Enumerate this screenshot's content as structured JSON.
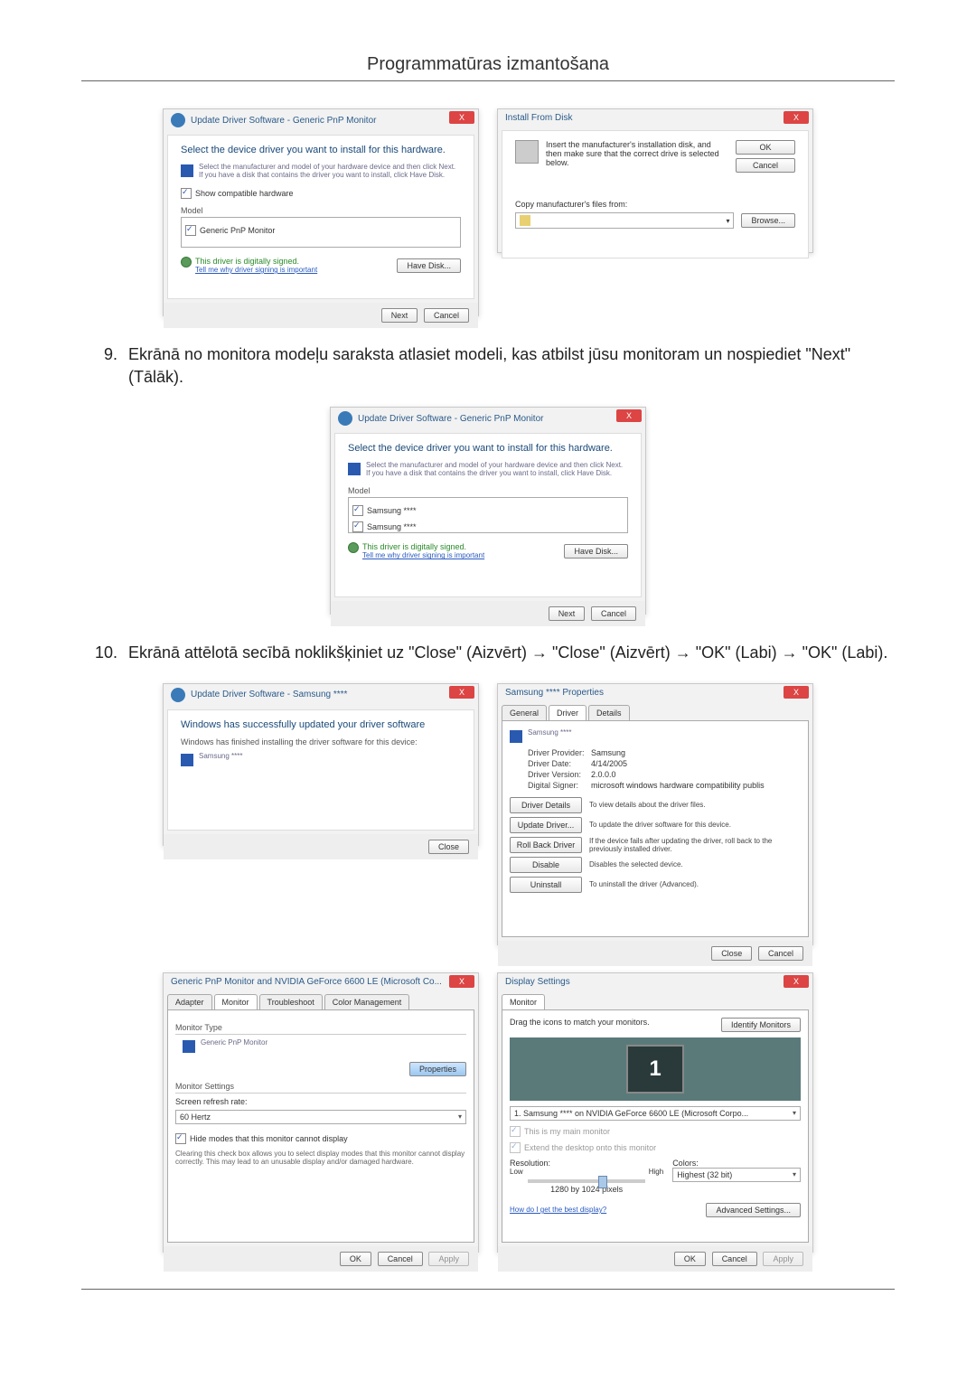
{
  "page": {
    "title": "Programmatūras izmantošana"
  },
  "steps": {
    "s9": {
      "num": "9.",
      "text": "Ekrānā no monitora modeļu saraksta atlasiet modeli, kas atbilst jūsu monitoram un nospiediet \"Next\" (Tālāk)."
    },
    "s10": {
      "num": "10.",
      "text": "Ekrānā attēlotā secībā noklikšķiniet uz \"Close\" (Aizvērt) → \"Close\" (Aizvērt) → \"OK\" (Labi) → \"OK\" (Labi)."
    }
  },
  "shot_update1": {
    "title": "Update Driver Software - Generic PnP Monitor",
    "heading": "Select the device driver you want to install for this hardware.",
    "note": "Select the manufacturer and model of your hardware device and then click Next. If you have a disk that contains the driver you want to install, click Have Disk.",
    "show_compat": "Show compatible hardware",
    "model_label": "Model",
    "model_item": "Generic PnP Monitor",
    "signed": "This driver is digitally signed.",
    "signed_link": "Tell me why driver signing is important",
    "have_disk": "Have Disk...",
    "next": "Next",
    "cancel": "Cancel"
  },
  "shot_install_disk": {
    "title": "Install From Disk",
    "instr": "Insert the manufacturer's installation disk, and then make sure that the correct drive is selected below.",
    "ok": "OK",
    "cancel": "Cancel",
    "copy_label": "Copy manufacturer's files from:",
    "browse": "Browse..."
  },
  "shot_update2": {
    "title": "Update Driver Software - Generic PnP Monitor",
    "heading": "Select the device driver you want to install for this hardware.",
    "note": "Select the manufacturer and model of your hardware device and then click Next. If you have a disk that contains the driver you want to install, click Have Disk.",
    "model_label": "Model",
    "model_item1": "Samsung ****",
    "model_item2": "Samsung ****",
    "signed": "This driver is digitally signed.",
    "signed_link": "Tell me why driver signing is important",
    "have_disk": "Have Disk...",
    "next": "Next",
    "cancel": "Cancel"
  },
  "shot_close": {
    "title": "Update Driver Software - Samsung ****",
    "heading": "Windows has successfully updated your driver software",
    "note": "Windows has finished installing the driver software for this device:",
    "device": "Samsung ****",
    "close": "Close"
  },
  "shot_props": {
    "title": "Samsung **** Properties",
    "tabs": {
      "general": "General",
      "driver": "Driver",
      "details": "Details"
    },
    "device": "Samsung ****",
    "provider_l": "Driver Provider:",
    "provider_v": "Samsung",
    "date_l": "Driver Date:",
    "date_v": "4/14/2005",
    "version_l": "Driver Version:",
    "version_v": "2.0.0.0",
    "signer_l": "Digital Signer:",
    "signer_v": "microsoft windows hardware compatibility publis",
    "b_details": "Driver Details",
    "d_details": "To view details about the driver files.",
    "b_update": "Update Driver...",
    "d_update": "To update the driver software for this device.",
    "b_rollback": "Roll Back Driver",
    "d_rollback": "If the device fails after updating the driver, roll back to the previously installed driver.",
    "b_disable": "Disable",
    "d_disable": "Disables the selected device.",
    "b_uninstall": "Uninstall",
    "d_uninstall": "To uninstall the driver (Advanced).",
    "close": "Close",
    "cancel": "Cancel"
  },
  "shot_monitor_tab": {
    "title": "Generic PnP Monitor and NVIDIA GeForce 6600 LE (Microsoft Co...",
    "tabs": {
      "adapter": "Adapter",
      "monitor": "Monitor",
      "troubleshoot": "Troubleshoot",
      "color": "Color Management"
    },
    "type_label": "Monitor Type",
    "type_value": "Generic PnP Monitor",
    "properties": "Properties",
    "settings_label": "Monitor Settings",
    "refresh_label": "Screen refresh rate:",
    "refresh_value": "60 Hertz",
    "hide_check": "Hide modes that this monitor cannot display",
    "hide_note": "Clearing this check box allows you to select display modes that this monitor cannot display correctly. This may lead to an unusable display and/or damaged hardware.",
    "ok": "OK",
    "cancel": "Cancel",
    "apply": "Apply"
  },
  "shot_display": {
    "title": "Display Settings",
    "tab": "Monitor",
    "drag": "Drag the icons to match your monitors.",
    "identify": "Identify Monitors",
    "monitor_num": "1",
    "combo": "1. Samsung **** on NVIDIA GeForce 6600 LE (Microsoft Corpo...",
    "chk_main": "This is my main monitor",
    "chk_extend": "Extend the desktop onto this monitor",
    "res_label": "Resolution:",
    "low": "Low",
    "high": "High",
    "res_value": "1280 by 1024 pixels",
    "colors_label": "Colors:",
    "colors_value": "Highest (32 bit)",
    "help_link": "How do I get the best display?",
    "advanced": "Advanced Settings...",
    "ok": "OK",
    "cancel": "Cancel",
    "apply": "Apply"
  }
}
